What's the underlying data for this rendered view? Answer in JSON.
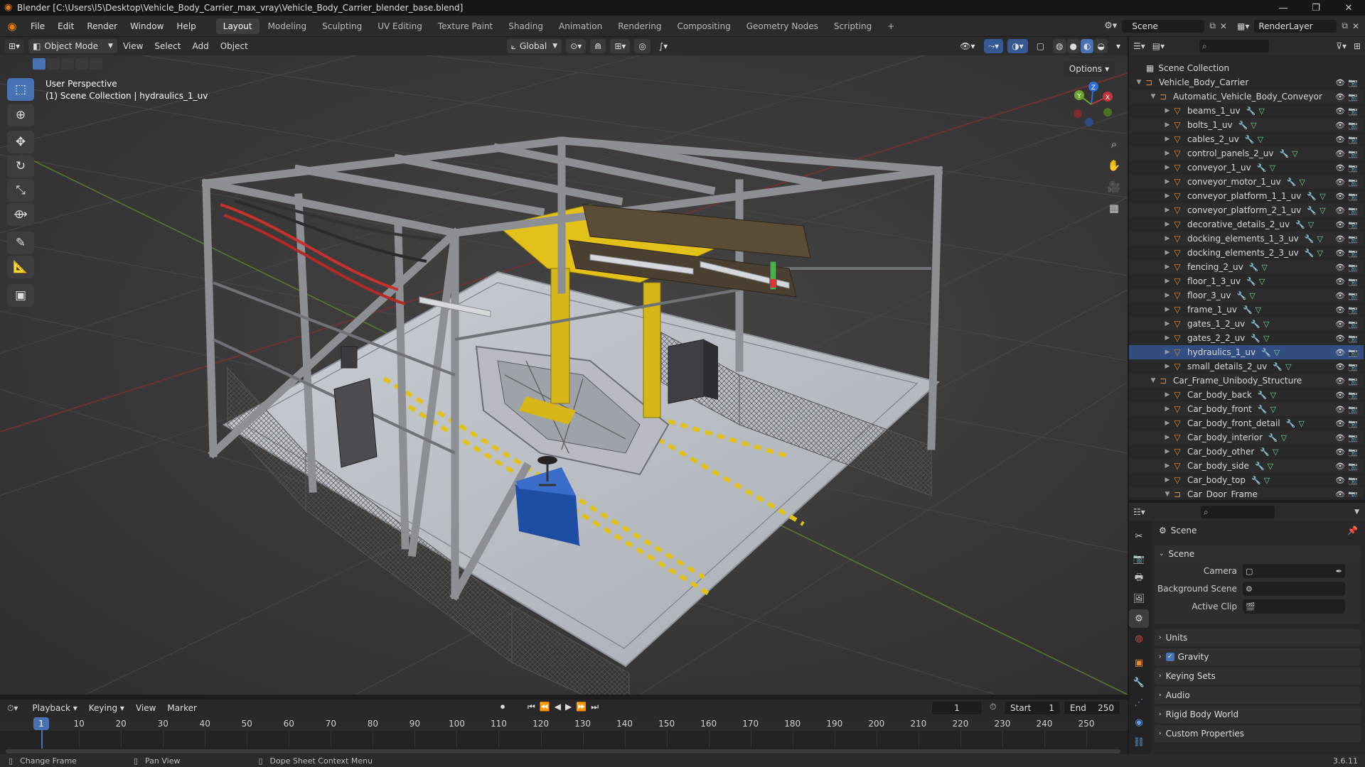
{
  "window": {
    "title": "Blender [C:\\Users\\l5\\Desktop\\Vehicle_Body_Carrier_max_vray\\Vehicle_Body_Carrier_blender_base.blend]"
  },
  "menus": [
    "File",
    "Edit",
    "Render",
    "Window",
    "Help"
  ],
  "workspaces": [
    "Layout",
    "Modeling",
    "Sculpting",
    "UV Editing",
    "Texture Paint",
    "Shading",
    "Animation",
    "Rendering",
    "Compositing",
    "Geometry Nodes",
    "Scripting"
  ],
  "active_workspace": "Layout",
  "add_workspace": "+",
  "scene_name": "Scene",
  "view_layer": "RenderLayer",
  "header": {
    "mode": "Object Mode",
    "view": "View",
    "select": "Select",
    "add": "Add",
    "object": "Object",
    "transform": "Global",
    "options": "Options"
  },
  "viewport": {
    "perspective": "User Perspective",
    "collection_info": "(1) Scene Collection | hydraulics_1_uv",
    "gizmo_axes": [
      "X",
      "Y",
      "Z"
    ]
  },
  "outliner": {
    "root": "Scene Collection",
    "rows": [
      {
        "label": "Vehicle_Body_Carrier",
        "type": "collection",
        "depth": 1,
        "expanded": true
      },
      {
        "label": "Automatic_Vehicle_Body_Conveyor",
        "type": "collection",
        "depth": 2,
        "expanded": true
      },
      {
        "label": "beams_1_uv",
        "type": "mesh",
        "depth": 3
      },
      {
        "label": "bolts_1_uv",
        "type": "mesh",
        "depth": 3
      },
      {
        "label": "cables_2_uv",
        "type": "mesh",
        "depth": 3
      },
      {
        "label": "control_panels_2_uv",
        "type": "mesh",
        "depth": 3
      },
      {
        "label": "conveyor_1_uv",
        "type": "mesh",
        "depth": 3
      },
      {
        "label": "conveyor_motor_1_uv",
        "type": "mesh",
        "depth": 3
      },
      {
        "label": "conveyor_platform_1_1_uv",
        "type": "mesh",
        "depth": 3
      },
      {
        "label": "conveyor_platform_2_1_uv",
        "type": "mesh",
        "depth": 3
      },
      {
        "label": "decorative_details_2_uv",
        "type": "mesh",
        "depth": 3
      },
      {
        "label": "docking_elements_1_3_uv",
        "type": "mesh",
        "depth": 3
      },
      {
        "label": "docking_elements_2_3_uv",
        "type": "mesh",
        "depth": 3
      },
      {
        "label": "fencing_2_uv",
        "type": "mesh",
        "depth": 3
      },
      {
        "label": "floor_1_3_uv",
        "type": "mesh",
        "depth": 3
      },
      {
        "label": "floor_3_uv",
        "type": "mesh",
        "depth": 3
      },
      {
        "label": "frame_1_uv",
        "type": "mesh",
        "depth": 3
      },
      {
        "label": "gates_1_2_uv",
        "type": "mesh",
        "depth": 3
      },
      {
        "label": "gates_2_2_uv",
        "type": "mesh",
        "depth": 3
      },
      {
        "label": "hydraulics_1_uv",
        "type": "mesh",
        "depth": 3,
        "active": true
      },
      {
        "label": "small_details_2_uv",
        "type": "mesh",
        "depth": 3
      },
      {
        "label": "Car_Frame_Unibody_Structure",
        "type": "collection",
        "depth": 2,
        "expanded": true
      },
      {
        "label": "Car_body_back",
        "type": "mesh",
        "depth": 3
      },
      {
        "label": "Car_body_front",
        "type": "mesh",
        "depth": 3
      },
      {
        "label": "Car_body_front_detail",
        "type": "mesh",
        "depth": 3
      },
      {
        "label": "Car_body_interior",
        "type": "mesh",
        "depth": 3
      },
      {
        "label": "Car_body_other",
        "type": "mesh",
        "depth": 3
      },
      {
        "label": "Car_body_side",
        "type": "mesh",
        "depth": 3
      },
      {
        "label": "Car_body_top",
        "type": "mesh",
        "depth": 3
      },
      {
        "label": "Car_Door_Frame",
        "type": "collection",
        "depth": 3,
        "expanded": true
      }
    ]
  },
  "properties": {
    "context": "Scene",
    "panel": "Scene",
    "camera_label": "Camera",
    "background_label": "Background Scene",
    "clip_label": "Active Clip",
    "sections": [
      "Units",
      "Gravity",
      "Keying Sets",
      "Audio",
      "Rigid Body World",
      "Custom Properties"
    ],
    "gravity_checked": true
  },
  "timeline": {
    "menus": [
      "Playback",
      "Keying",
      "View",
      "Marker"
    ],
    "current_frame": "1",
    "start_label": "Start",
    "start": "1",
    "end_label": "End",
    "end": "250",
    "ticks": [
      "1",
      "10",
      "20",
      "30",
      "40",
      "50",
      "60",
      "70",
      "80",
      "90",
      "100",
      "110",
      "120",
      "130",
      "140",
      "150",
      "160",
      "170",
      "180",
      "190",
      "200",
      "210",
      "220",
      "230",
      "240",
      "250"
    ]
  },
  "status": {
    "left": "Change Frame",
    "mid": "Pan View",
    "right": "Dope Sheet Context Menu",
    "version": "3.6.11"
  },
  "colors": {
    "accent": "#4772b3",
    "mesh": "#e88a32",
    "yellow": "#e2c21a",
    "axis_x": "#c0343d",
    "axis_y": "#6aa52c",
    "axis_z": "#2f6fd8"
  }
}
